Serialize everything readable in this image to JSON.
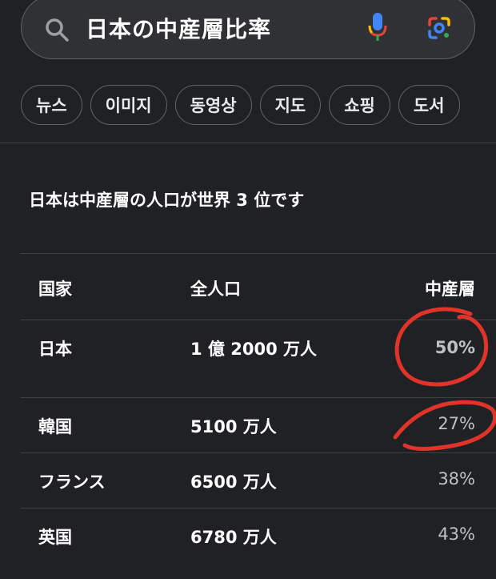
{
  "search": {
    "query": "日本の中産層比率"
  },
  "chips": [
    "뉴스",
    "이미지",
    "동영상",
    "지도",
    "쇼핑",
    "도서"
  ],
  "headline": "日本は中産層の人口が世界 3 位です",
  "table": {
    "headers": [
      "国家",
      "全人口",
      "中産層"
    ],
    "rows": [
      {
        "country": "日本",
        "population": "1 億 2000 万人",
        "middle": "50%"
      },
      {
        "country": "韓国",
        "population": "5100 万人",
        "middle": "27%"
      },
      {
        "country": "フランス",
        "population": "6500 万人",
        "middle": "38%"
      },
      {
        "country": "英国",
        "population": "6780 万人",
        "middle": "43%"
      }
    ]
  },
  "colors": {
    "background": "#202124",
    "annotation": "#e0342a"
  }
}
